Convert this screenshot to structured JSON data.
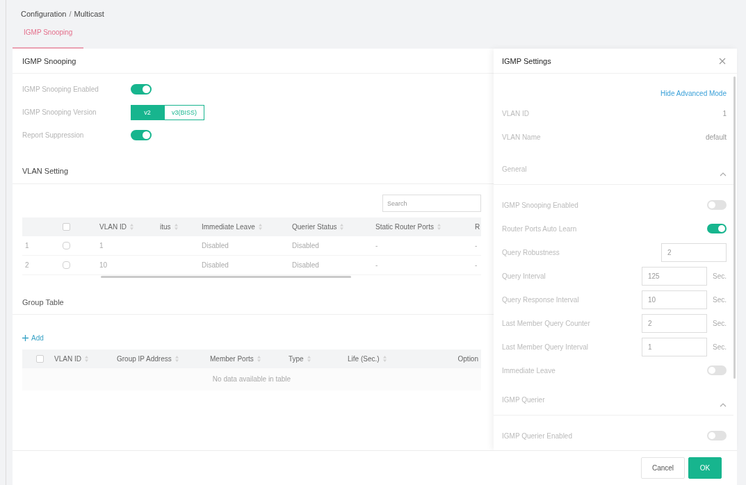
{
  "breadcrumb": {
    "items": [
      "Configuration",
      "Multicast"
    ],
    "separator": "/"
  },
  "tabs": [
    {
      "label": "IGMP Snooping",
      "selected": true
    }
  ],
  "main": {
    "title": "IGMP Snooping",
    "settings": [
      {
        "kind": "toggle",
        "label": "IGMP Snooping Enabled",
        "on": true
      },
      {
        "kind": "segmented",
        "label": "IGMP Snooping Version",
        "options": [
          {
            "label": "v2",
            "selected": true
          },
          {
            "label": "v3(BISS)",
            "selected": false
          }
        ]
      },
      {
        "kind": "toggle",
        "label": "Report Suppression",
        "on": true
      }
    ],
    "vlan_setting": {
      "title": "VLAN Setting",
      "search": {
        "placeholder": "Search"
      },
      "header_checked": false,
      "columns": [
        {
          "label": "VLAN ID",
          "sortable": true
        },
        {
          "label": "itus",
          "sortable": true
        },
        {
          "label": "Immediate Leave",
          "sortable": true
        },
        {
          "label": "Querier Status",
          "sortable": true
        },
        {
          "label": "Static Router Ports",
          "sortable": true
        },
        {
          "label": "R",
          "sortable": false
        }
      ],
      "rows": [
        {
          "number": "1",
          "checked": false,
          "cells": [
            "1",
            null,
            "Disabled",
            "Disabled",
            "-",
            "-"
          ]
        },
        {
          "number": "2",
          "checked": false,
          "cells": [
            "10",
            null,
            "Disabled",
            "Disabled",
            "-",
            "-"
          ]
        }
      ]
    },
    "group_table": {
      "title": "Group Table",
      "add_label": "Add",
      "header_checked": false,
      "columns": [
        {
          "label": "VLAN ID",
          "sortable": true
        },
        {
          "label": "Group IP Address",
          "sortable": true
        },
        {
          "label": "Member Ports",
          "sortable": true
        },
        {
          "label": "Type",
          "sortable": true
        },
        {
          "label": "Life (Sec.)",
          "sortable": true
        },
        {
          "label": "Option",
          "sortable": false
        }
      ],
      "empty_message": "No data available in table"
    }
  },
  "drawer": {
    "title": "IGMP Settings",
    "advanced_link": "Hide Advanced Mode",
    "info": [
      {
        "label": "VLAN ID",
        "value": "1"
      },
      {
        "label": "VLAN Name",
        "value": "default"
      }
    ],
    "sections": [
      {
        "title": "General",
        "expanded": true,
        "fields": [
          {
            "kind": "toggle",
            "label": "IGMP Snooping Enabled",
            "on": false
          },
          {
            "kind": "toggle",
            "label": "Router Ports Auto Learn",
            "on": true
          },
          {
            "kind": "input",
            "label": "Query Robustness",
            "value": "2"
          },
          {
            "kind": "input",
            "label": "Query Interval",
            "value": "125",
            "unit": "Sec."
          },
          {
            "kind": "input",
            "label": "Query Response Interval",
            "value": "10",
            "unit": "Sec."
          },
          {
            "kind": "input",
            "label": "Last Member Query Counter",
            "value": "2",
            "unit": "Sec."
          },
          {
            "kind": "input",
            "label": "Last Member Query Interval",
            "value": "1",
            "unit": "Sec."
          },
          {
            "kind": "toggle",
            "label": "Immediate Leave",
            "on": false
          }
        ]
      },
      {
        "title": "IGMP Querier",
        "expanded": true,
        "fields": [
          {
            "kind": "toggle",
            "label": "IGMP Querier Enabled",
            "on": false
          }
        ]
      }
    ]
  },
  "footer": {
    "buttons": [
      {
        "label": "Cancel",
        "kind": "secondary"
      },
      {
        "label": "OK",
        "kind": "primary"
      }
    ]
  }
}
